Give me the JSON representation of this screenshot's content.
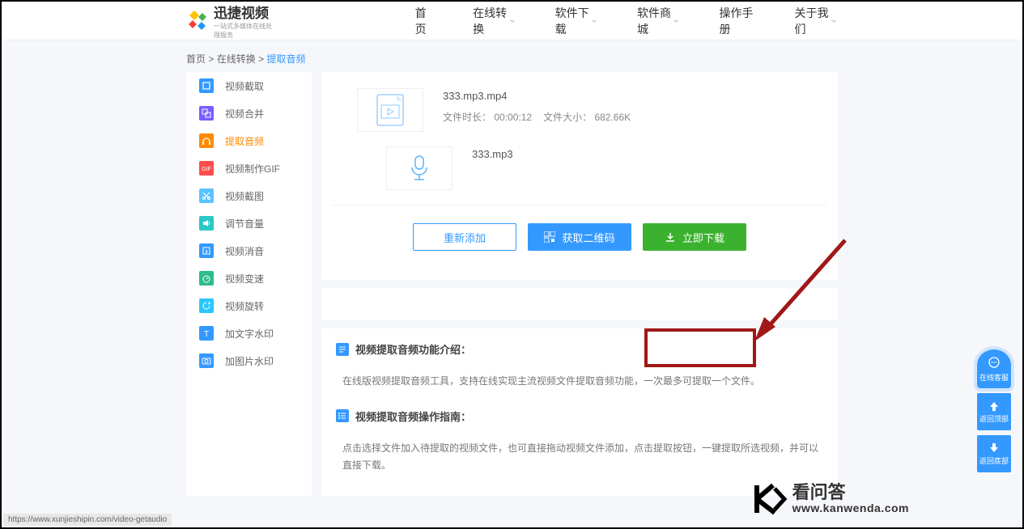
{
  "header": {
    "logo_text": "迅捷视频",
    "logo_sub": "一站式多媒体在线处理服务"
  },
  "nav": {
    "home": "首页",
    "convert": "在线转换",
    "download": "软件下载",
    "store": "软件商城",
    "manual": "操作手册",
    "about": "关于我们"
  },
  "breadcrumb": {
    "home": "首页",
    "sep": ">",
    "convert": "在线转换",
    "current": "提取音频"
  },
  "sidebar": {
    "items": [
      {
        "label": "视频截取",
        "color": "#3499ff"
      },
      {
        "label": "视频合并",
        "color": "#7a5cff"
      },
      {
        "label": "提取音频",
        "color": "#ff8a00",
        "active": true
      },
      {
        "label": "视频制作GIF",
        "color": "#ff4d4d"
      },
      {
        "label": "视频截图",
        "color": "#59c3ff"
      },
      {
        "label": "调节音量",
        "color": "#2bc6c6"
      },
      {
        "label": "视频消音",
        "color": "#3499ff"
      },
      {
        "label": "视频变速",
        "color": "#2ebb8f"
      },
      {
        "label": "视频旋转",
        "color": "#2bc6ff"
      },
      {
        "label": "加文字水印",
        "color": "#3499ff"
      },
      {
        "label": "加图片水印",
        "color": "#3499ff"
      }
    ]
  },
  "file_in": {
    "name": "333.mp3.mp4",
    "duration_label": "文件时长：",
    "duration": "00:00:12",
    "size_label": "文件大小：",
    "size": "682.66K"
  },
  "file_out": {
    "name": "333.mp3"
  },
  "actions": {
    "readd": "重新添加",
    "qr": "获取二维码",
    "download": "立即下载"
  },
  "info": {
    "title1": "视频提取音频功能介绍：",
    "body1": "在线版视频提取音频工具，支持在线实现主流视频文件提取音频功能，一次最多可提取一个文件。",
    "title2": "视频提取音频操作指南：",
    "body2": "点击选择文件加入待提取的视频文件，也可直接拖动视频文件添加，点击提取按钮，一键提取所选视频，并可以直接下载。"
  },
  "float": {
    "service": "在线客服",
    "top": "返回顶部",
    "bottom": "返回底部"
  },
  "watermark": {
    "big": "看问答",
    "url": "www.kanwenda.com"
  },
  "status_url": "https://www.xunjieshipin.com/video-getaudio"
}
